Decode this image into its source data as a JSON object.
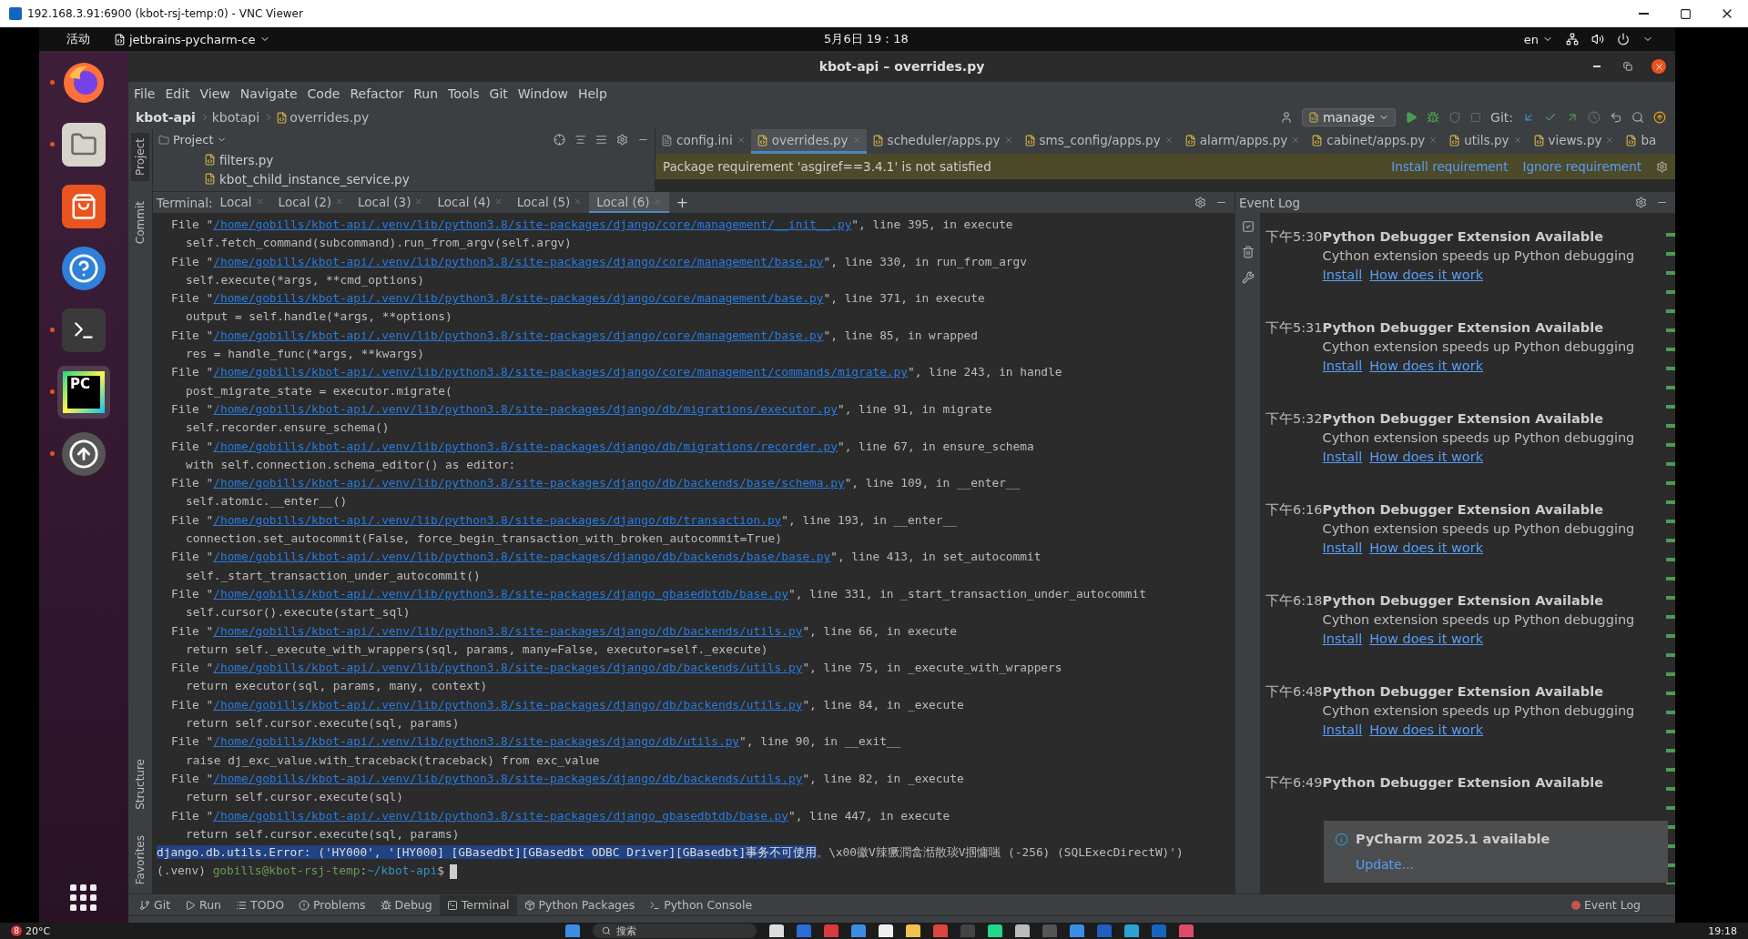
{
  "vnc_window": {
    "title": "192.168.3.91:6900 (kbot-rsj-temp:0) - VNC Viewer"
  },
  "top_bar": {
    "activities": "活动",
    "app_menu": "jetbrains-pycharm-ce",
    "clock": "5月6日  19：18",
    "language": "en"
  },
  "dock": {
    "items": [
      {
        "kind": "firefox",
        "running": true,
        "selected": false
      },
      {
        "kind": "files",
        "running": true,
        "selected": false
      },
      {
        "kind": "appcenter",
        "running": false,
        "selected": false
      },
      {
        "kind": "help",
        "running": false,
        "selected": false
      },
      {
        "kind": "terminal",
        "running": true,
        "selected": false
      },
      {
        "kind": "pycharm",
        "running": true,
        "selected": true,
        "logo_text": "PC"
      },
      {
        "kind": "updater",
        "running": true,
        "selected": false
      }
    ]
  },
  "ide": {
    "title": "kbot-api – overrides.py",
    "menu": [
      "File",
      "Edit",
      "View",
      "Navigate",
      "Code",
      "Refactor",
      "Run",
      "Tools",
      "Git",
      "Window",
      "Help"
    ],
    "breadcrumbs": [
      "kbot-api",
      "kbotapi",
      "overrides.py"
    ],
    "run_config": "manage",
    "git_label": "Git:",
    "left_strip_top": [
      {
        "label": "Project",
        "selected": true
      },
      {
        "label": "Commit",
        "selected": false
      }
    ],
    "left_strip_bottom": [
      {
        "label": "Structure",
        "selected": false
      },
      {
        "label": "Favorites",
        "selected": false
      }
    ],
    "project": {
      "title": "Project",
      "files": [
        "filters.py",
        "kbot_child_instance_service.py"
      ]
    },
    "editor_tabs": [
      {
        "label": "config.ini",
        "selected": false
      },
      {
        "label": "overrides.py",
        "selected": true
      },
      {
        "label": "scheduler/apps.py",
        "selected": false
      },
      {
        "label": "sms_config/apps.py",
        "selected": false
      },
      {
        "label": "alarm/apps.py",
        "selected": false
      },
      {
        "label": "cabinet/apps.py",
        "selected": false
      },
      {
        "label": "utils.py",
        "selected": false
      },
      {
        "label": "views.py",
        "selected": false
      },
      {
        "label": "ba",
        "selected": false
      }
    ],
    "notice": {
      "text": "Package requirement 'asgiref==3.4.1' is not satisfied",
      "actions": [
        "Install requirement",
        "Ignore requirement"
      ]
    },
    "terminal": {
      "label": "Terminal:",
      "add": "+",
      "tabs": [
        {
          "label": "Local",
          "selected": false
        },
        {
          "label": "Local (2)",
          "selected": false
        },
        {
          "label": "Local (3)",
          "selected": false
        },
        {
          "label": "Local (4)",
          "selected": false
        },
        {
          "label": "Local (5)",
          "selected": false
        },
        {
          "label": "Local (6)",
          "selected": true
        }
      ],
      "lines": [
        {
          "kind": "frame",
          "before": "File \"",
          "link": "/home/gobills/kbot-api/.venv/lib/python3.8/site-packages/django/core/management/__init__.py",
          "after": "\", line 395, in execute"
        },
        {
          "kind": "code",
          "text": "self.fetch_command(subcommand).run_from_argv(self.argv)"
        },
        {
          "kind": "frame",
          "before": "File \"",
          "link": "/home/gobills/kbot-api/.venv/lib/python3.8/site-packages/django/core/management/base.py",
          "after": "\", line 330, in run_from_argv"
        },
        {
          "kind": "code",
          "text": "self.execute(*args, **cmd_options)"
        },
        {
          "kind": "frame",
          "before": "File \"",
          "link": "/home/gobills/kbot-api/.venv/lib/python3.8/site-packages/django/core/management/base.py",
          "after": "\", line 371, in execute"
        },
        {
          "kind": "code",
          "text": "output = self.handle(*args, **options)"
        },
        {
          "kind": "frame",
          "before": "File \"",
          "link": "/home/gobills/kbot-api/.venv/lib/python3.8/site-packages/django/core/management/base.py",
          "after": "\", line 85, in wrapped"
        },
        {
          "kind": "code",
          "text": "res = handle_func(*args, **kwargs)"
        },
        {
          "kind": "frame",
          "before": "File \"",
          "link": "/home/gobills/kbot-api/.venv/lib/python3.8/site-packages/django/core/management/commands/migrate.py",
          "after": "\", line 243, in handle"
        },
        {
          "kind": "code",
          "text": "post_migrate_state = executor.migrate("
        },
        {
          "kind": "frame",
          "before": "File \"",
          "link": "/home/gobills/kbot-api/.venv/lib/python3.8/site-packages/django/db/migrations/executor.py",
          "after": "\", line 91, in migrate"
        },
        {
          "kind": "code",
          "text": "self.recorder.ensure_schema()"
        },
        {
          "kind": "frame",
          "before": "File \"",
          "link": "/home/gobills/kbot-api/.venv/lib/python3.8/site-packages/django/db/migrations/recorder.py",
          "after": "\", line 67, in ensure_schema"
        },
        {
          "kind": "code",
          "text": "with self.connection.schema_editor() as editor:"
        },
        {
          "kind": "frame",
          "before": "File \"",
          "link": "/home/gobills/kbot-api/.venv/lib/python3.8/site-packages/django/db/backends/base/schema.py",
          "after": "\", line 109, in __enter__"
        },
        {
          "kind": "code",
          "text": "self.atomic.__enter__()"
        },
        {
          "kind": "frame",
          "before": "File \"",
          "link": "/home/gobills/kbot-api/.venv/lib/python3.8/site-packages/django/db/transaction.py",
          "after": "\", line 193, in __enter__"
        },
        {
          "kind": "code",
          "text": "connection.set_autocommit(False, force_begin_transaction_with_broken_autocommit=True)"
        },
        {
          "kind": "frame",
          "before": "File \"",
          "link": "/home/gobills/kbot-api/.venv/lib/python3.8/site-packages/django/db/backends/base/base.py",
          "after": "\", line 413, in set_autocommit"
        },
        {
          "kind": "code",
          "text": "self._start_transaction_under_autocommit()"
        },
        {
          "kind": "frame",
          "before": "File \"",
          "link": "/home/gobills/kbot-api/.venv/lib/python3.8/site-packages/django_gbasedbtdb/base.py",
          "after": "\", line 331, in _start_transaction_under_autocommit"
        },
        {
          "kind": "code",
          "text": "self.cursor().execute(start_sql)"
        },
        {
          "kind": "frame",
          "before": "File \"",
          "link": "/home/gobills/kbot-api/.venv/lib/python3.8/site-packages/django/db/backends/utils.py",
          "after": "\", line 66, in execute"
        },
        {
          "kind": "code",
          "text": "return self._execute_with_wrappers(sql, params, many=False, executor=self._execute)"
        },
        {
          "kind": "frame",
          "before": "File \"",
          "link": "/home/gobills/kbot-api/.venv/lib/python3.8/site-packages/django/db/backends/utils.py",
          "after": "\", line 75, in _execute_with_wrappers"
        },
        {
          "kind": "code",
          "text": "return executor(sql, params, many, context)"
        },
        {
          "kind": "frame",
          "before": "File \"",
          "link": "/home/gobills/kbot-api/.venv/lib/python3.8/site-packages/django/db/backends/utils.py",
          "after": "\", line 84, in _execute"
        },
        {
          "kind": "code",
          "text": "return self.cursor.execute(sql, params)"
        },
        {
          "kind": "frame",
          "before": "File \"",
          "link": "/home/gobills/kbot-api/.venv/lib/python3.8/site-packages/django/db/utils.py",
          "after": "\", line 90, in __exit__"
        },
        {
          "kind": "code",
          "text": "raise dj_exc_value.with_traceback(traceback) from exc_value"
        },
        {
          "kind": "frame",
          "before": "File \"",
          "link": "/home/gobills/kbot-api/.venv/lib/python3.8/site-packages/django/db/backends/utils.py",
          "after": "\", line 82, in _execute"
        },
        {
          "kind": "code",
          "text": "return self.cursor.execute(sql)"
        },
        {
          "kind": "frame",
          "before": "File \"",
          "link": "/home/gobills/kbot-api/.venv/lib/python3.8/site-packages/django_gbasedbtdb/base.py",
          "after": "\", line 447, in execute"
        },
        {
          "kind": "code",
          "text": "return self.cursor.execute(sql, params)"
        },
        {
          "kind": "error",
          "highlighted": "django.db.utils.Error: ('HY000', '[HY000] [GBasedbt][GBasedbt ODBC Driver][GBasedbt]事务不可使用",
          "rest": "。\\x00徽V辣獗潤畣湉散琰V掴慵嗤 (-256) (SQLExecDirectW)')"
        },
        {
          "kind": "prompt",
          "env": "(.venv) ",
          "user": "gobills@kbot-rsj-temp",
          "sep": ":",
          "path": "~/kbot-api",
          "symbol": "$"
        }
      ]
    },
    "event_log": {
      "title": "Event Log",
      "entries": [
        {
          "time": "下午5:30",
          "title": "Python Debugger Extension Available",
          "body": "Cython extension speeds up Python debugging",
          "links": [
            "Install",
            "How does it work"
          ]
        },
        {
          "time": "下午5:31",
          "title": "Python Debugger Extension Available",
          "body": "Cython extension speeds up Python debugging",
          "links": [
            "Install",
            "How does it work"
          ]
        },
        {
          "time": "下午5:32",
          "title": "Python Debugger Extension Available",
          "body": "Cython extension speeds up Python debugging",
          "links": [
            "Install",
            "How does it work"
          ]
        },
        {
          "time": "下午6:16",
          "title": "Python Debugger Extension Available",
          "body": "Cython extension speeds up Python debugging",
          "links": [
            "Install",
            "How does it work"
          ]
        },
        {
          "time": "下午6:18",
          "title": "Python Debugger Extension Available",
          "body": "Cython extension speeds up Python debugging",
          "links": [
            "Install",
            "How does it work"
          ]
        },
        {
          "time": "下午6:48",
          "title": "Python Debugger Extension Available",
          "body": "Cython extension speeds up Python debugging",
          "links": [
            "Install",
            "How does it work"
          ]
        },
        {
          "time": "下午6:49",
          "title": "Python Debugger Extension Available"
        }
      ],
      "popup": {
        "title": "PyCharm 2025.1 available",
        "link": "Update..."
      }
    },
    "bottom_tools": [
      {
        "kind": "git",
        "label": "Git",
        "selected": false
      },
      {
        "kind": "run",
        "label": "Run",
        "selected": false
      },
      {
        "kind": "todo",
        "label": "TODO",
        "selected": false
      },
      {
        "kind": "problems",
        "label": "Problems",
        "selected": false
      },
      {
        "kind": "debug",
        "label": "Debug",
        "selected": false
      },
      {
        "kind": "terminal",
        "label": "Terminal",
        "selected": true
      },
      {
        "kind": "packages",
        "label": "Python Packages",
        "selected": false
      },
      {
        "kind": "console",
        "label": "Python Console",
        "selected": false
      }
    ],
    "event_log_button": "Event Log"
  },
  "taskbar": {
    "weather_badge": "8",
    "temperature": "20°C",
    "search": "搜索",
    "clock": "19:18"
  }
}
